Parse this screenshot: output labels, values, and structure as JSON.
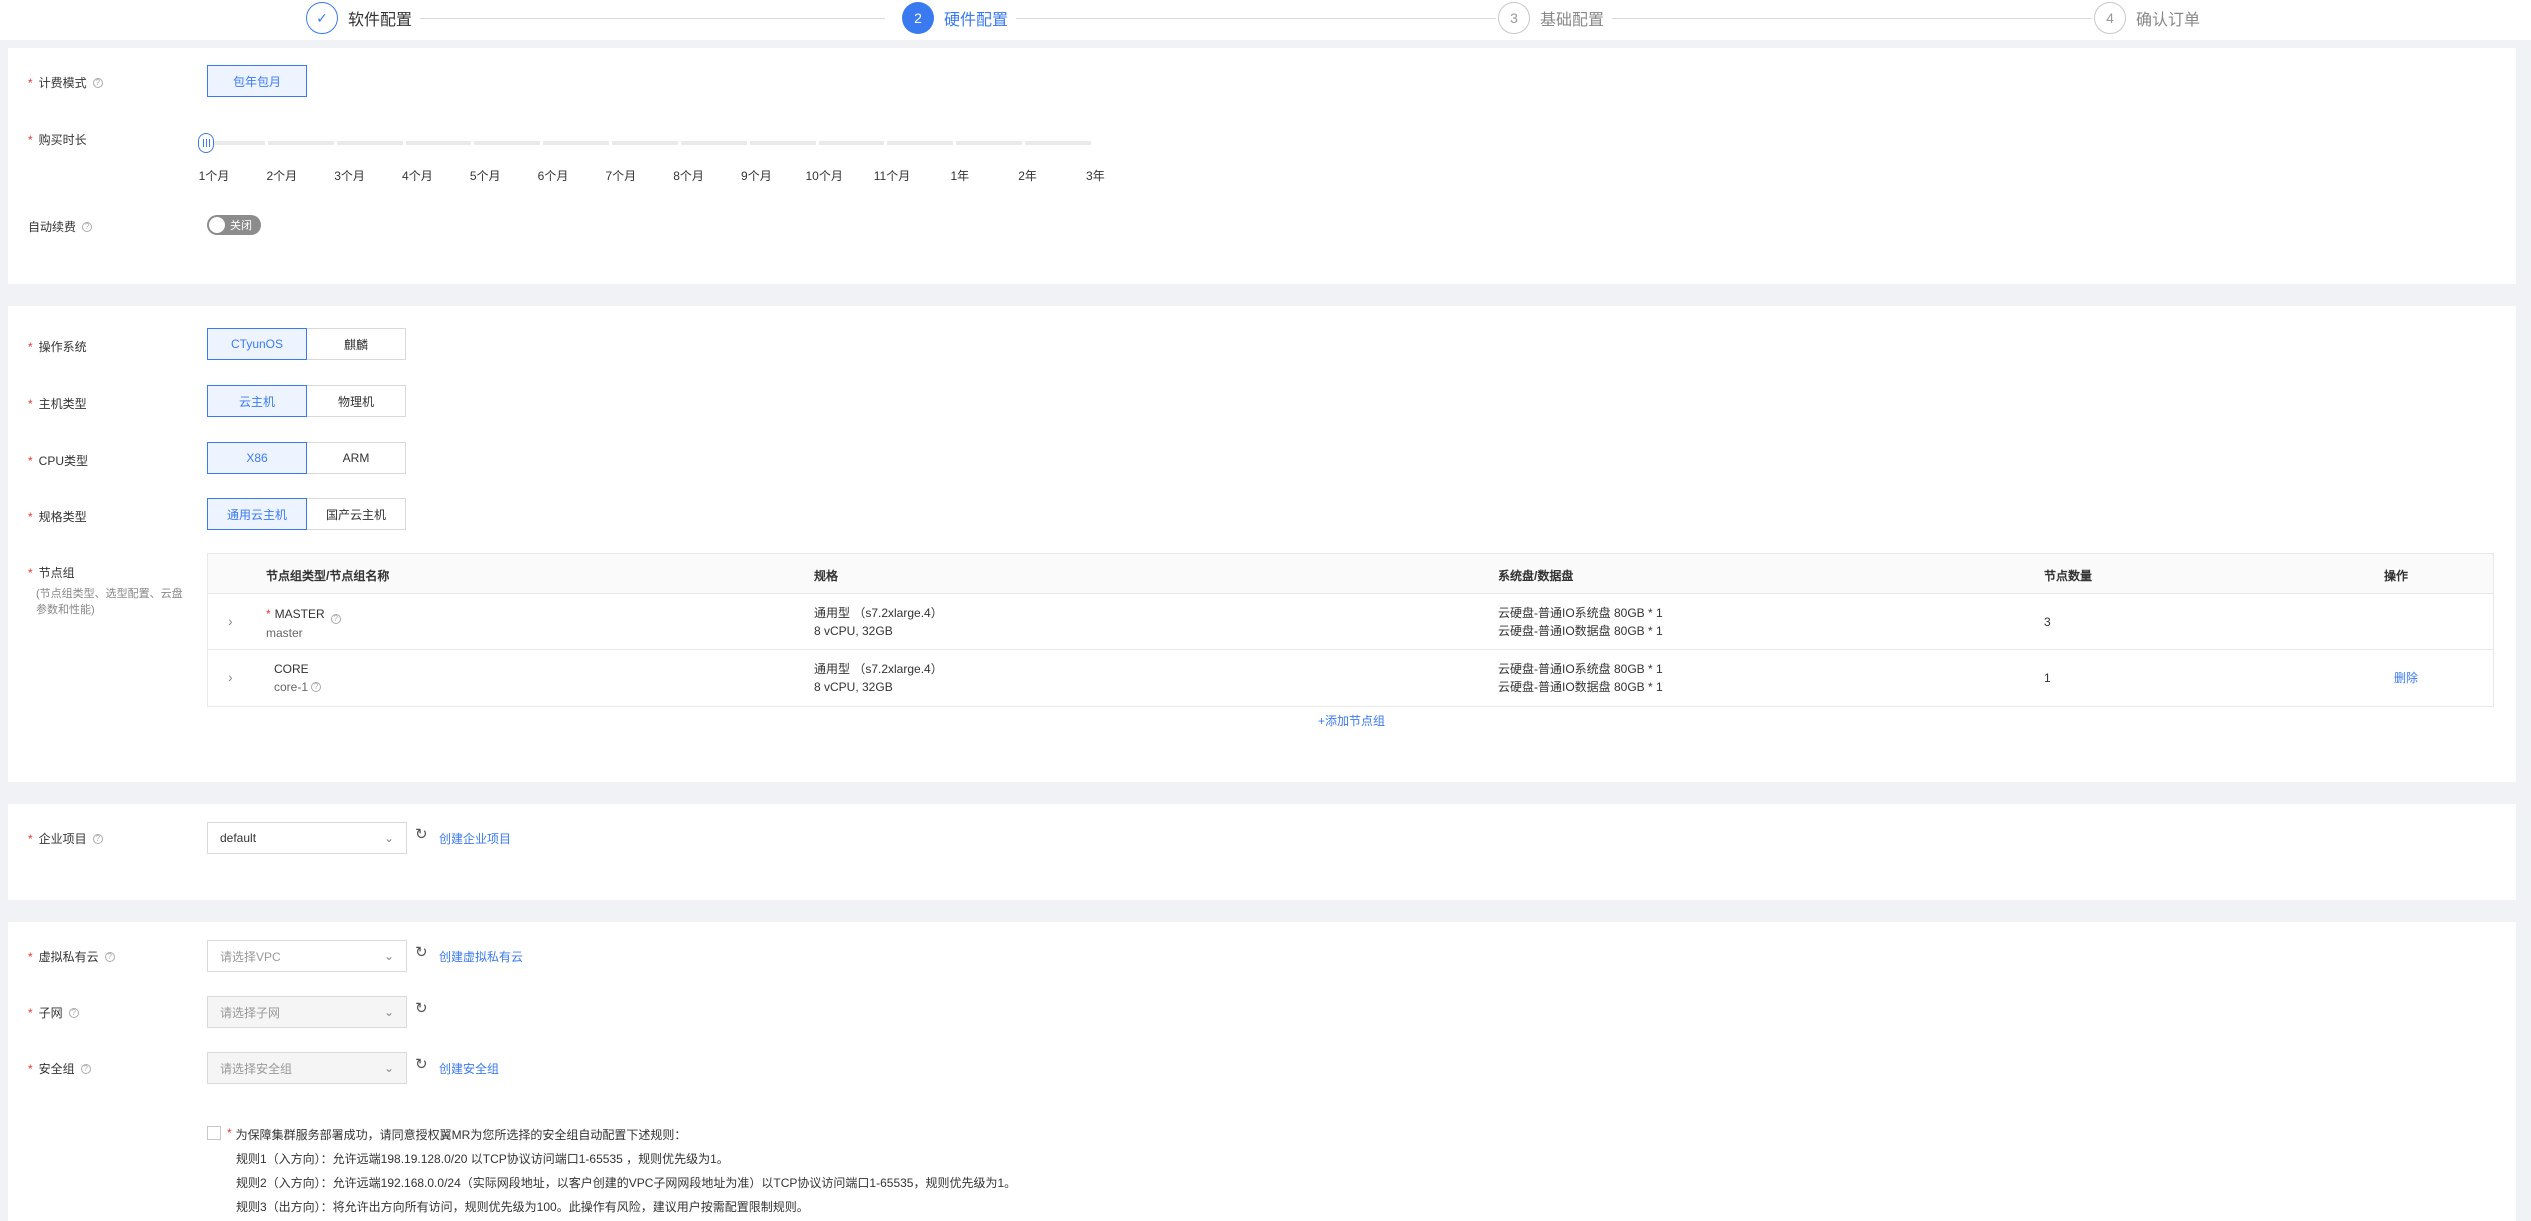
{
  "steps": [
    {
      "num": "✓",
      "label": "软件配置",
      "state": "done"
    },
    {
      "num": "2",
      "label": "硬件配置",
      "state": "active"
    },
    {
      "num": "3",
      "label": "基础配置",
      "state": "todo"
    },
    {
      "num": "4",
      "label": "确认订单",
      "state": "todo"
    }
  ],
  "billing": {
    "mode_label": "计费模式",
    "mode_option": "包年包月",
    "duration_label": "购买时长",
    "duration_ticks": [
      "1个月",
      "2个月",
      "3个月",
      "4个月",
      "5个月",
      "6个月",
      "7个月",
      "8个月",
      "9个月",
      "10个月",
      "11个月",
      "1年",
      "2年",
      "3年"
    ],
    "duration_selected": "1个月",
    "auto_renew_label": "自动续费",
    "auto_renew_state": "关闭"
  },
  "hardware": {
    "os_label": "操作系统",
    "os_options": [
      "CTyunOS",
      "麒麟"
    ],
    "host_label": "主机类型",
    "host_options": [
      "云主机",
      "物理机"
    ],
    "cpu_label": "CPU类型",
    "cpu_options": [
      "X86",
      "ARM"
    ],
    "spec_label": "规格类型",
    "spec_options": [
      "通用云主机",
      "国产云主机"
    ],
    "node_label": "节点组",
    "node_desc_1": "(节点组类型、选型配置、云盘",
    "node_desc_2": "参数和性能)",
    "table": {
      "headers": [
        "节点组类型/节点组名称",
        "规格",
        "系统盘/数据盘",
        "节点数量",
        "操作"
      ],
      "rows": [
        {
          "type": "MASTER",
          "name": "master",
          "spec1": "通用型 （s7.2xlarge.4）",
          "spec2": "8 vCPU, 32GB",
          "disk1": "云硬盘-普通IO系统盘 80GB * 1",
          "disk2": "云硬盘-普通IO数据盘 80GB * 1",
          "count": "3",
          "action": ""
        },
        {
          "type": "CORE",
          "name": "core-1",
          "spec1": "通用型 （s7.2xlarge.4）",
          "spec2": "8 vCPU, 32GB",
          "disk1": "云硬盘-普通IO系统盘 80GB * 1",
          "disk2": "云硬盘-普通IO数据盘 80GB * 1",
          "count": "1",
          "action": "删除"
        }
      ]
    },
    "add_group": "+添加节点组"
  },
  "project": {
    "label": "企业项目",
    "value": "default",
    "create_link": "创建企业项目"
  },
  "network": {
    "vpc_label": "虚拟私有云",
    "vpc_placeholder": "请选择VPC",
    "vpc_link": "创建虚拟私有云",
    "subnet_label": "子网",
    "subnet_placeholder": "请选择子网",
    "sg_label": "安全组",
    "sg_placeholder": "请选择安全组",
    "sg_link": "创建安全组",
    "rule_title": "为保障集群服务部署成功，请同意授权翼MR为您所选择的安全组自动配置下述规则：",
    "rules": [
      "规则1（入方向）：允许远端198.19.128.0/20 以TCP协议访问端口1-65535 ，规则优先级为1。",
      "规则2（入方向）：允许远端192.168.0.0/24（实际网段地址，以客户创建的VPC子网网段地址为准）以TCP协议访问端口1-65535，规则优先级为1。",
      "规则3（出方向）：将允许出方向所有访问，规则优先级为100。此操作有风险，建议用户按需配置限制规则。"
    ]
  },
  "colors": {
    "accent": "#3a7af0",
    "required": "#e53935",
    "toggle_off": "#8c8c8c"
  }
}
